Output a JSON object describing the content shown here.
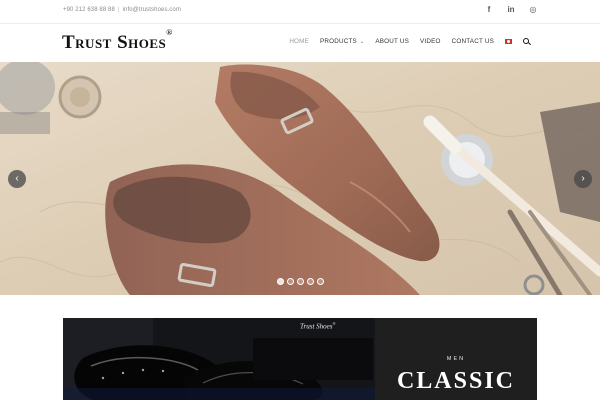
{
  "topbar": {
    "phone": "+90 212 638 88 88",
    "separator": "|",
    "email": "info@trustshoes.com",
    "social": [
      {
        "icon": "facebook-icon",
        "glyph": "f"
      },
      {
        "icon": "linkedin-icon",
        "glyph": "in"
      },
      {
        "icon": "instagram-icon",
        "glyph": "◎"
      }
    ]
  },
  "header": {
    "logo_text": "Trust Shoes",
    "logo_mark": "®",
    "nav": {
      "home": "HOME",
      "products": "PRODUCTS",
      "about": "ABOUT US",
      "video": "VIDEO",
      "contact": "CONTACT US"
    },
    "language_flag": "turkey-flag-icon",
    "search_icon": "search-icon"
  },
  "slider": {
    "prev": "‹",
    "next": "›",
    "slide_count": 5,
    "active_slide": 1
  },
  "promo": {
    "brand_text": "Trust Shoes",
    "brand_mark": "®",
    "category": "MEN",
    "collection": "CLASSIC"
  },
  "colors": {
    "accent": "#d32f2f",
    "nav_active": "#9a9a9a",
    "promo_panel": "#1f1f1f"
  }
}
